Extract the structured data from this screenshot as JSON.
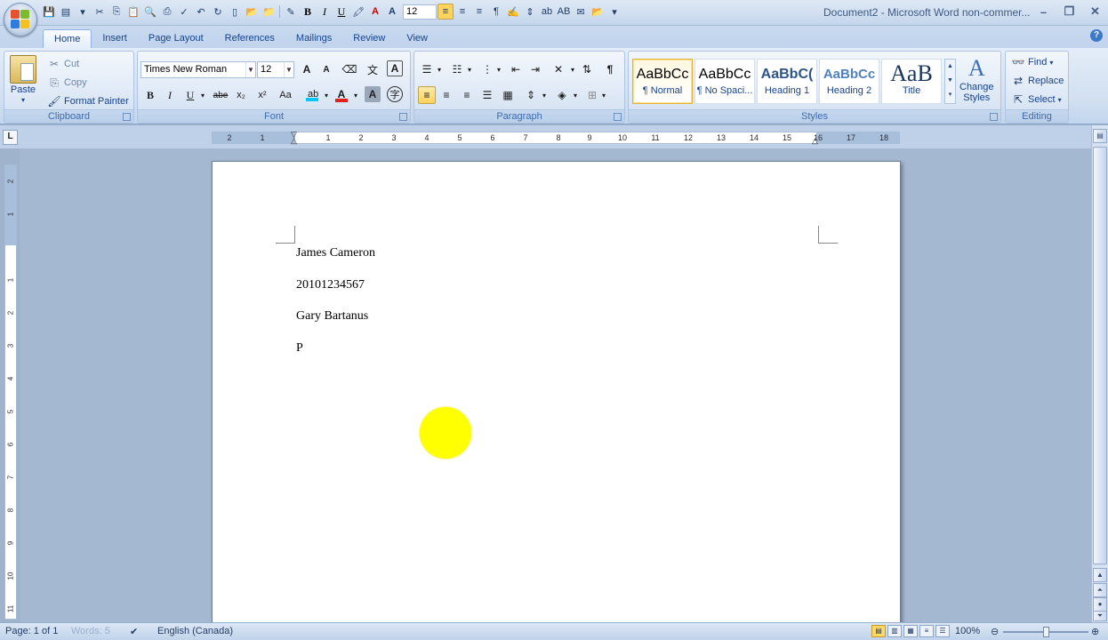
{
  "window": {
    "title": "Document2 - Microsoft Word non-commer...",
    "controls": [
      "–",
      "❐",
      "✕"
    ]
  },
  "qat": {
    "font_size": "12"
  },
  "ribbon_tabs": [
    "Home",
    "Insert",
    "Page Layout",
    "References",
    "Mailings",
    "Review",
    "View"
  ],
  "active_tab": "Home",
  "clipboard": {
    "group_label": "Clipboard",
    "paste": "Paste",
    "cut": "Cut",
    "copy": "Copy",
    "format_painter": "Format Painter"
  },
  "font": {
    "group_label": "Font",
    "family": "Times New Roman",
    "size": "12",
    "bold": "B",
    "italic": "I",
    "underline": "U",
    "strike": "abe",
    "subscript": "x₂",
    "superscript": "x²",
    "change_case": "Aa",
    "grow": "A",
    "shrink": "A",
    "font_color": "A",
    "highlight_color": "#00c8ff",
    "font_color_swatch": "#e0201a"
  },
  "paragraph": {
    "group_label": "Paragraph"
  },
  "styles": {
    "group_label": "Styles",
    "items": [
      {
        "preview": "AaBbCc",
        "name": "¶ Normal"
      },
      {
        "preview": "AaBbCc",
        "name": "¶ No Spaci..."
      },
      {
        "preview": "AaBbC(",
        "name": "Heading 1"
      },
      {
        "preview": "AaBbCc",
        "name": "Heading 2"
      },
      {
        "preview": "AaB",
        "name": "Title"
      }
    ],
    "change_styles_line1": "Change",
    "change_styles_line2": "Styles"
  },
  "editing": {
    "group_label": "Editing",
    "find": "Find",
    "replace": "Replace",
    "select": "Select"
  },
  "ruler": {
    "tab_selector": "L",
    "h_numbers": [
      "2",
      "1",
      "1",
      "2",
      "3",
      "4",
      "5",
      "6",
      "7",
      "8",
      "9",
      "10",
      "11",
      "12",
      "13",
      "14",
      "15",
      "16",
      "17",
      "18"
    ],
    "v_numbers": [
      "2",
      "1",
      "1",
      "2",
      "3",
      "4",
      "5",
      "6",
      "7",
      "8",
      "9",
      "10",
      "11"
    ]
  },
  "document": {
    "lines": [
      "James Cameron",
      "20101234567",
      "Gary Bartanus",
      "P"
    ]
  },
  "status": {
    "page": "Page: 1 of 1",
    "words": "Words: 5",
    "language": "English (Canada)",
    "zoom": "100%"
  }
}
